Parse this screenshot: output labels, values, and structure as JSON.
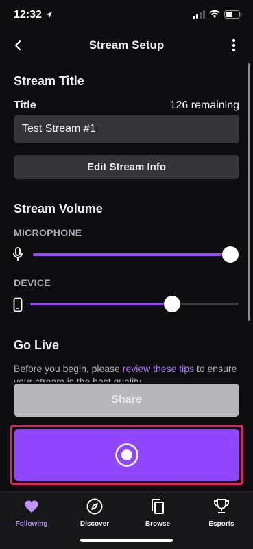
{
  "status_bar": {
    "time": "12:32"
  },
  "nav": {
    "title": "Stream Setup"
  },
  "stream_title": {
    "heading": "Stream Title",
    "field_label": "Title",
    "remaining": "126 remaining",
    "value": "Test Stream #1",
    "edit_button": "Edit Stream Info"
  },
  "stream_volume": {
    "heading": "Stream Volume",
    "microphone_label": "MICROPHONE",
    "microphone_level": 1.0,
    "device_label": "DEVICE",
    "device_level": 0.68
  },
  "go_live": {
    "heading": "Go Live",
    "text_before": "Before you begin, please ",
    "link_text": "review these tips",
    "text_after": " to ensure your stream is the best quality.",
    "share_button": "Share"
  },
  "tabs": [
    {
      "label": "Following",
      "icon": "heart-icon",
      "active": true
    },
    {
      "label": "Discover",
      "icon": "compass-icon",
      "active": false
    },
    {
      "label": "Browse",
      "icon": "browse-icon",
      "active": false
    },
    {
      "label": "Esports",
      "icon": "trophy-icon",
      "active": false
    }
  ],
  "colors": {
    "accent": "#9147ff",
    "background": "#0e0e10",
    "highlight_border": "#e0245e",
    "active_tab": "#bf94ff"
  }
}
